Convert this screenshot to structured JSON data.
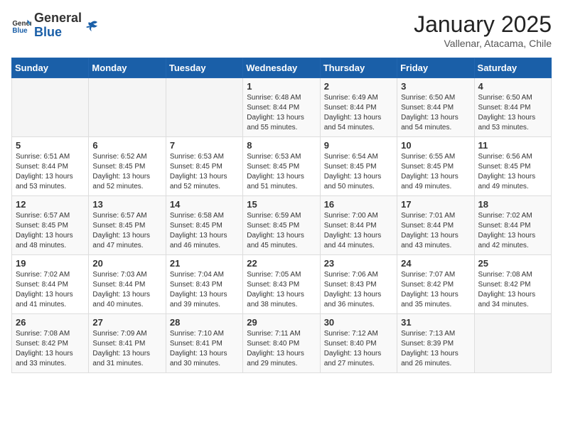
{
  "header": {
    "logo_general": "General",
    "logo_blue": "Blue",
    "title": "January 2025",
    "subtitle": "Vallenar, Atacama, Chile"
  },
  "weekdays": [
    "Sunday",
    "Monday",
    "Tuesday",
    "Wednesday",
    "Thursday",
    "Friday",
    "Saturday"
  ],
  "weeks": [
    [
      {
        "day": "",
        "sunrise": "",
        "sunset": "",
        "daylight": ""
      },
      {
        "day": "",
        "sunrise": "",
        "sunset": "",
        "daylight": ""
      },
      {
        "day": "",
        "sunrise": "",
        "sunset": "",
        "daylight": ""
      },
      {
        "day": "1",
        "sunrise": "Sunrise: 6:48 AM",
        "sunset": "Sunset: 8:44 PM",
        "daylight": "Daylight: 13 hours and 55 minutes."
      },
      {
        "day": "2",
        "sunrise": "Sunrise: 6:49 AM",
        "sunset": "Sunset: 8:44 PM",
        "daylight": "Daylight: 13 hours and 54 minutes."
      },
      {
        "day": "3",
        "sunrise": "Sunrise: 6:50 AM",
        "sunset": "Sunset: 8:44 PM",
        "daylight": "Daylight: 13 hours and 54 minutes."
      },
      {
        "day": "4",
        "sunrise": "Sunrise: 6:50 AM",
        "sunset": "Sunset: 8:44 PM",
        "daylight": "Daylight: 13 hours and 53 minutes."
      }
    ],
    [
      {
        "day": "5",
        "sunrise": "Sunrise: 6:51 AM",
        "sunset": "Sunset: 8:44 PM",
        "daylight": "Daylight: 13 hours and 53 minutes."
      },
      {
        "day": "6",
        "sunrise": "Sunrise: 6:52 AM",
        "sunset": "Sunset: 8:45 PM",
        "daylight": "Daylight: 13 hours and 52 minutes."
      },
      {
        "day": "7",
        "sunrise": "Sunrise: 6:53 AM",
        "sunset": "Sunset: 8:45 PM",
        "daylight": "Daylight: 13 hours and 52 minutes."
      },
      {
        "day": "8",
        "sunrise": "Sunrise: 6:53 AM",
        "sunset": "Sunset: 8:45 PM",
        "daylight": "Daylight: 13 hours and 51 minutes."
      },
      {
        "day": "9",
        "sunrise": "Sunrise: 6:54 AM",
        "sunset": "Sunset: 8:45 PM",
        "daylight": "Daylight: 13 hours and 50 minutes."
      },
      {
        "day": "10",
        "sunrise": "Sunrise: 6:55 AM",
        "sunset": "Sunset: 8:45 PM",
        "daylight": "Daylight: 13 hours and 49 minutes."
      },
      {
        "day": "11",
        "sunrise": "Sunrise: 6:56 AM",
        "sunset": "Sunset: 8:45 PM",
        "daylight": "Daylight: 13 hours and 49 minutes."
      }
    ],
    [
      {
        "day": "12",
        "sunrise": "Sunrise: 6:57 AM",
        "sunset": "Sunset: 8:45 PM",
        "daylight": "Daylight: 13 hours and 48 minutes."
      },
      {
        "day": "13",
        "sunrise": "Sunrise: 6:57 AM",
        "sunset": "Sunset: 8:45 PM",
        "daylight": "Daylight: 13 hours and 47 minutes."
      },
      {
        "day": "14",
        "sunrise": "Sunrise: 6:58 AM",
        "sunset": "Sunset: 8:45 PM",
        "daylight": "Daylight: 13 hours and 46 minutes."
      },
      {
        "day": "15",
        "sunrise": "Sunrise: 6:59 AM",
        "sunset": "Sunset: 8:45 PM",
        "daylight": "Daylight: 13 hours and 45 minutes."
      },
      {
        "day": "16",
        "sunrise": "Sunrise: 7:00 AM",
        "sunset": "Sunset: 8:44 PM",
        "daylight": "Daylight: 13 hours and 44 minutes."
      },
      {
        "day": "17",
        "sunrise": "Sunrise: 7:01 AM",
        "sunset": "Sunset: 8:44 PM",
        "daylight": "Daylight: 13 hours and 43 minutes."
      },
      {
        "day": "18",
        "sunrise": "Sunrise: 7:02 AM",
        "sunset": "Sunset: 8:44 PM",
        "daylight": "Daylight: 13 hours and 42 minutes."
      }
    ],
    [
      {
        "day": "19",
        "sunrise": "Sunrise: 7:02 AM",
        "sunset": "Sunset: 8:44 PM",
        "daylight": "Daylight: 13 hours and 41 minutes."
      },
      {
        "day": "20",
        "sunrise": "Sunrise: 7:03 AM",
        "sunset": "Sunset: 8:44 PM",
        "daylight": "Daylight: 13 hours and 40 minutes."
      },
      {
        "day": "21",
        "sunrise": "Sunrise: 7:04 AM",
        "sunset": "Sunset: 8:43 PM",
        "daylight": "Daylight: 13 hours and 39 minutes."
      },
      {
        "day": "22",
        "sunrise": "Sunrise: 7:05 AM",
        "sunset": "Sunset: 8:43 PM",
        "daylight": "Daylight: 13 hours and 38 minutes."
      },
      {
        "day": "23",
        "sunrise": "Sunrise: 7:06 AM",
        "sunset": "Sunset: 8:43 PM",
        "daylight": "Daylight: 13 hours and 36 minutes."
      },
      {
        "day": "24",
        "sunrise": "Sunrise: 7:07 AM",
        "sunset": "Sunset: 8:42 PM",
        "daylight": "Daylight: 13 hours and 35 minutes."
      },
      {
        "day": "25",
        "sunrise": "Sunrise: 7:08 AM",
        "sunset": "Sunset: 8:42 PM",
        "daylight": "Daylight: 13 hours and 34 minutes."
      }
    ],
    [
      {
        "day": "26",
        "sunrise": "Sunrise: 7:08 AM",
        "sunset": "Sunset: 8:42 PM",
        "daylight": "Daylight: 13 hours and 33 minutes."
      },
      {
        "day": "27",
        "sunrise": "Sunrise: 7:09 AM",
        "sunset": "Sunset: 8:41 PM",
        "daylight": "Daylight: 13 hours and 31 minutes."
      },
      {
        "day": "28",
        "sunrise": "Sunrise: 7:10 AM",
        "sunset": "Sunset: 8:41 PM",
        "daylight": "Daylight: 13 hours and 30 minutes."
      },
      {
        "day": "29",
        "sunrise": "Sunrise: 7:11 AM",
        "sunset": "Sunset: 8:40 PM",
        "daylight": "Daylight: 13 hours and 29 minutes."
      },
      {
        "day": "30",
        "sunrise": "Sunrise: 7:12 AM",
        "sunset": "Sunset: 8:40 PM",
        "daylight": "Daylight: 13 hours and 27 minutes."
      },
      {
        "day": "31",
        "sunrise": "Sunrise: 7:13 AM",
        "sunset": "Sunset: 8:39 PM",
        "daylight": "Daylight: 13 hours and 26 minutes."
      },
      {
        "day": "",
        "sunrise": "",
        "sunset": "",
        "daylight": ""
      }
    ]
  ]
}
